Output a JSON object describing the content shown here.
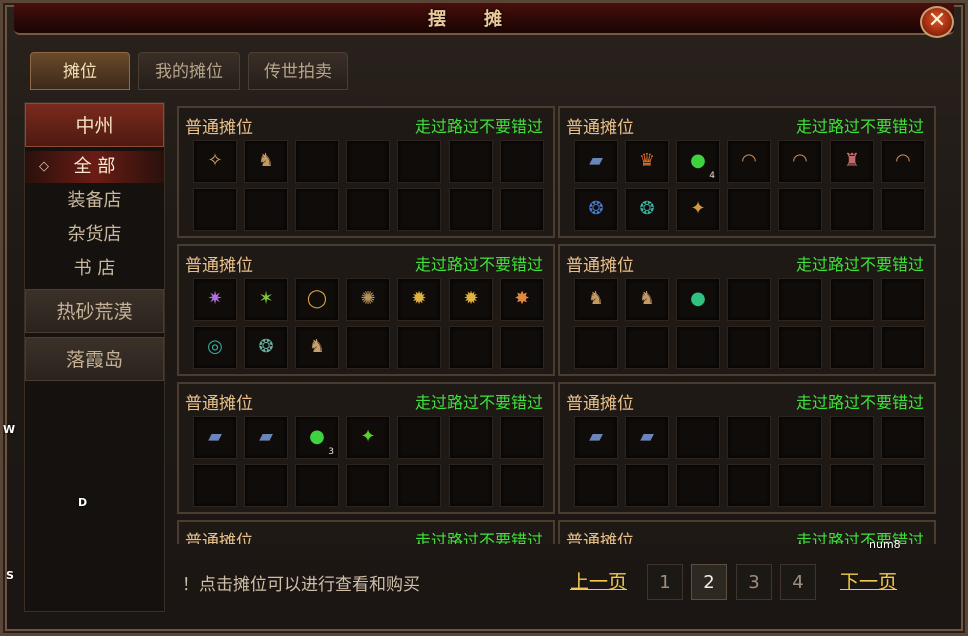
{
  "window": {
    "title": "摆摊",
    "close_symbol": "✕"
  },
  "tabs": [
    {
      "label": "摊位",
      "active": true
    },
    {
      "label": "我的摊位",
      "active": false
    },
    {
      "label": "传世拍卖",
      "active": false
    }
  ],
  "sidebar": {
    "regions": [
      {
        "label": "中州",
        "active": true,
        "subitems": [
          {
            "label": "全 部",
            "active": true,
            "bullet": "◇"
          },
          {
            "label": "装备店",
            "active": false
          },
          {
            "label": "杂货店",
            "active": false
          },
          {
            "label": "书 店",
            "active": false
          }
        ]
      },
      {
        "label": "热砂荒漠",
        "active": false
      },
      {
        "label": "落霞岛",
        "active": false
      }
    ]
  },
  "stalls": [
    {
      "title": "普通摊位",
      "slogan": "走过路过不要错过",
      "items": [
        {
          "icon": "ring-icon",
          "glyph": "✧",
          "color": "#d4a65a"
        },
        {
          "icon": "helmet-icon",
          "glyph": "♞",
          "color": "#c49a64"
        }
      ]
    },
    {
      "title": "普通摊位",
      "slogan": "走过路过不要错过",
      "items": [
        {
          "icon": "book-icon",
          "glyph": "▰",
          "color": "#6a86b8"
        },
        {
          "icon": "helmet-icon",
          "glyph": "♛",
          "color": "#d86a2a"
        },
        {
          "icon": "green-orb-icon",
          "glyph": "●",
          "color": "#3fd23f",
          "count": "4"
        },
        {
          "icon": "bracelet-icon",
          "glyph": "◠",
          "color": "#c98a5a"
        },
        {
          "icon": "bracelet-icon",
          "glyph": "◠",
          "color": "#c98a5a"
        },
        {
          "icon": "boots-icon",
          "glyph": "♜",
          "color": "#c06a6a"
        },
        {
          "icon": "bracelet-icon",
          "glyph": "◠",
          "color": "#c98a5a"
        },
        {
          "icon": "necklace-icon",
          "glyph": "❂",
          "color": "#4a7ac8"
        },
        {
          "icon": "necklace-icon",
          "glyph": "❂",
          "color": "#3ab0a0"
        },
        {
          "icon": "amulet-icon",
          "glyph": "✦",
          "color": "#d09a40"
        }
      ]
    },
    {
      "title": "普通摊位",
      "slogan": "走过路过不要错过",
      "items": [
        {
          "icon": "staff-icon",
          "glyph": "✷",
          "color": "#b070e0"
        },
        {
          "icon": "wand-icon",
          "glyph": "✶",
          "color": "#7ac83a"
        },
        {
          "icon": "ring-icon",
          "glyph": "◯",
          "color": "#d4a040"
        },
        {
          "icon": "amulet-icon",
          "glyph": "✺",
          "color": "#b8905a"
        },
        {
          "icon": "spark-icon",
          "glyph": "✹",
          "color": "#e0b040"
        },
        {
          "icon": "spark-icon",
          "glyph": "✹",
          "color": "#e0b040"
        },
        {
          "icon": "amulet-icon",
          "glyph": "✸",
          "color": "#e08a40"
        },
        {
          "icon": "ring-icon",
          "glyph": "◎",
          "color": "#3ab0a0"
        },
        {
          "icon": "necklace-icon",
          "glyph": "❂",
          "color": "#6ab0a0"
        },
        {
          "icon": "helmet-icon",
          "glyph": "♞",
          "color": "#c8a070"
        }
      ]
    },
    {
      "title": "普通摊位",
      "slogan": "走过路过不要错过",
      "items": [
        {
          "icon": "helmet-icon",
          "glyph": "♞",
          "color": "#c49a64"
        },
        {
          "icon": "helmet-icon",
          "glyph": "♞",
          "color": "#c49a64"
        },
        {
          "icon": "jade-orb-icon",
          "glyph": "●",
          "color": "#30c080"
        }
      ]
    },
    {
      "title": "普通摊位",
      "slogan": "走过路过不要错过",
      "items": [
        {
          "icon": "book-icon",
          "glyph": "▰",
          "color": "#6a86b8"
        },
        {
          "icon": "book-icon",
          "glyph": "▰",
          "color": "#6a86b8"
        },
        {
          "icon": "green-orb-icon",
          "glyph": "●",
          "color": "#3fd23f",
          "count": "3"
        },
        {
          "icon": "green-leaf-icon",
          "glyph": "✦",
          "color": "#5ad02a"
        }
      ]
    },
    {
      "title": "普通摊位",
      "slogan": "走过路过不要错过",
      "items": [
        {
          "icon": "book-icon",
          "glyph": "▰",
          "color": "#6a86b8"
        },
        {
          "icon": "book-icon",
          "glyph": "▰",
          "color": "#6a86b8"
        }
      ]
    },
    {
      "title": "普通摊位",
      "slogan": "走过路过不要错过",
      "items": []
    },
    {
      "title": "普通摊位",
      "slogan": "走过路过不要错过",
      "items": []
    }
  ],
  "footer": {
    "hint": "！点击摊位可以进行查看和购买",
    "prev": "上一页",
    "next": "下一页",
    "pages": [
      {
        "label": "1",
        "current": false
      },
      {
        "label": "2",
        "current": true
      },
      {
        "label": "3",
        "current": false
      },
      {
        "label": "4",
        "current": false
      }
    ]
  },
  "overlay_keys": {
    "w": "W",
    "d": "D",
    "s": "S",
    "num8": "num8"
  }
}
